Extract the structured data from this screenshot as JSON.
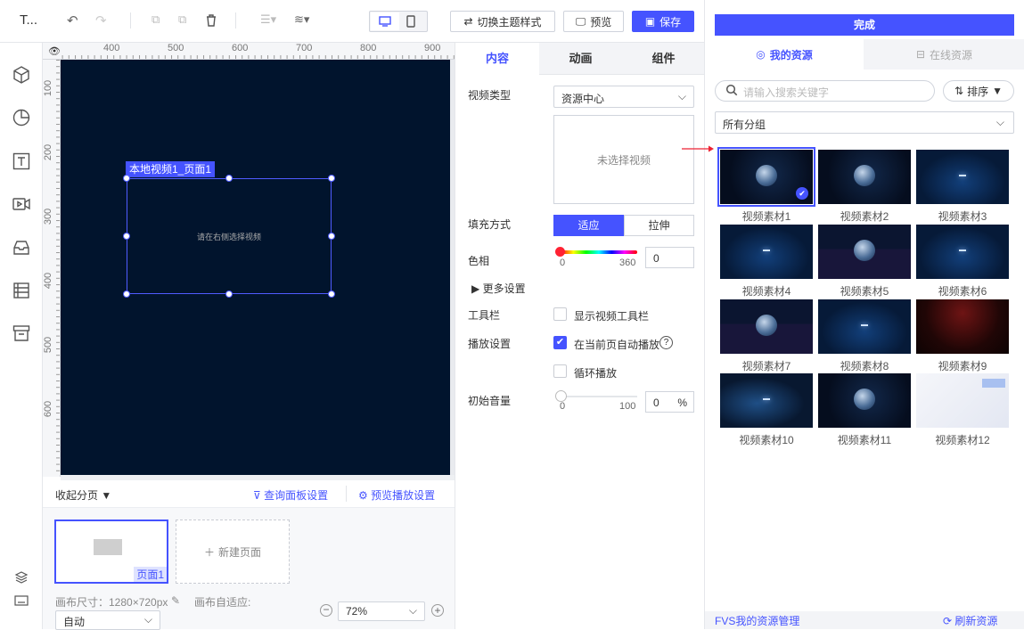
{
  "app": {
    "title": "T..."
  },
  "toolbar": {
    "switch_theme": "切换主题样式",
    "preview": "预览",
    "save": "保存"
  },
  "ruler": {
    "top_ticks": [
      "400",
      "500",
      "600",
      "700",
      "800",
      "900"
    ],
    "left_ticks": [
      "100",
      "200",
      "300",
      "400",
      "500",
      "600"
    ]
  },
  "canvas": {
    "element_tag": "本地视频1_页面1",
    "hint": "请在右侧选择视频"
  },
  "pages": {
    "collapse": "收起分页",
    "query_panel": "查询面板设置",
    "preview_settings": "预览播放设置",
    "page1": "页面1",
    "new_page": "新建页面"
  },
  "status": {
    "canvas_size": "画布尺寸：1280×720px",
    "auto_fit": "画布自适应:",
    "auto_value": "自动",
    "zoom": "72%"
  },
  "props": {
    "tabs": [
      "内容",
      "动画",
      "组件"
    ],
    "video_type_label": "视频类型",
    "video_type_value": "资源中心",
    "no_video": "未选择视频",
    "fill_label": "填充方式",
    "fill_fit": "适应",
    "fill_stretch": "拉伸",
    "hue_label": "色相",
    "hue_min": "0",
    "hue_max": "360",
    "hue_value": "0",
    "more_settings": "更多设置",
    "toolbar_label": "工具栏",
    "show_toolbar": "显示视频工具栏",
    "play_label": "播放设置",
    "autoplay": "在当前页自动播放",
    "loop": "循环播放",
    "volume_label": "初始音量",
    "vol_min": "0",
    "vol_max": "100",
    "vol_value": "0",
    "vol_unit": "%"
  },
  "assets": {
    "done": "完成",
    "my_tab": "我的资源",
    "online_tab": "在线资源",
    "search_placeholder": "请输入搜索关键字",
    "sort": "排序",
    "group": "所有分组",
    "items": [
      "视频素材1",
      "视频素材2",
      "视频素材3",
      "视频素材4",
      "视频素材5",
      "视频素材6",
      "视频素材7",
      "视频素材8",
      "视频素材9",
      "视频素材10",
      "视频素材11",
      "视频素材12"
    ],
    "manage": "FVS我的资源管理",
    "refresh": "刷新资源"
  },
  "colors": {
    "accent": "#4553ff",
    "canvas_bg": "#01142d"
  }
}
